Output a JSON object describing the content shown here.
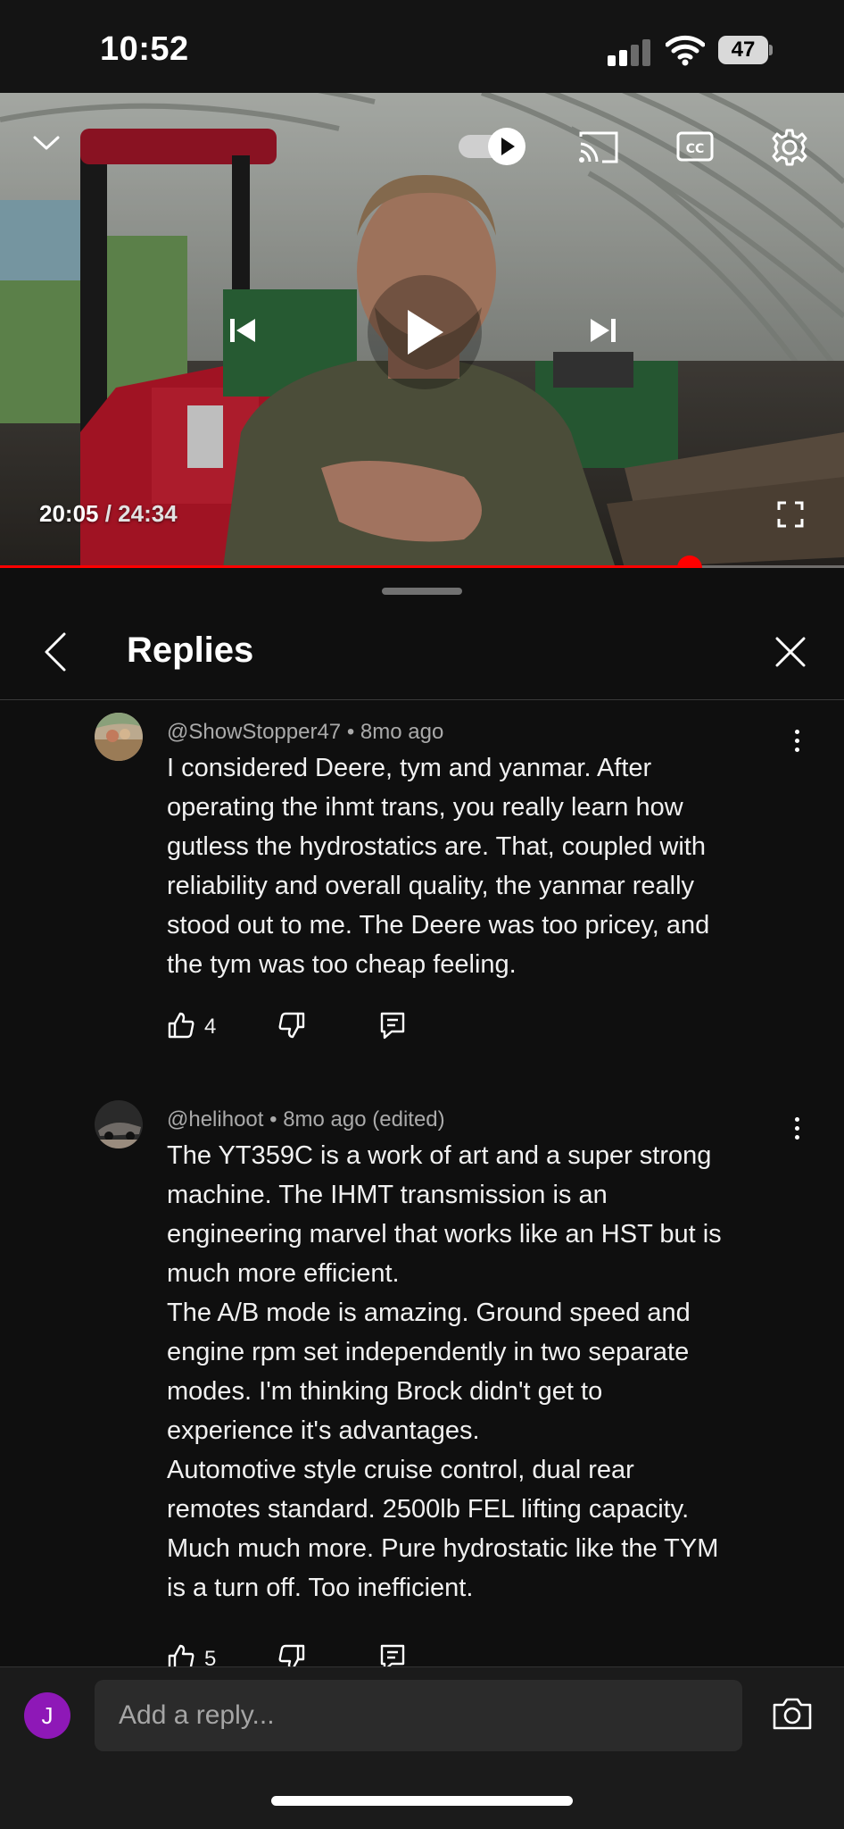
{
  "status_bar": {
    "time": "10:52",
    "battery_level": "47"
  },
  "player": {
    "current_time": "20:05",
    "separator": " / ",
    "duration": "24:34",
    "progress_fraction": 0.817,
    "autoplay_on": true,
    "progress_color": "#ff0000",
    "icons": [
      "collapse-chevron-icon",
      "autoplay-toggle-icon",
      "cast-icon",
      "captions-icon",
      "settings-gear-icon",
      "previous-icon",
      "play-icon",
      "next-icon",
      "fullscreen-icon"
    ]
  },
  "panel": {
    "title": "Replies"
  },
  "comments": [
    {
      "author": "@ShowStopper47",
      "time": "8mo ago",
      "edited": "",
      "lines": [
        "I considered Deere, tym and yanmar. After",
        "operating the ihmt trans, you really learn how",
        "gutless the hydrostatics are.  That, coupled with",
        "reliability and overall quality, the yanmar really",
        "stood out to me. The Deere was too pricey, and",
        "the tym was too cheap feeling."
      ],
      "likes": "4"
    },
    {
      "author": "@helihoot",
      "time": "8mo ago",
      "edited": "(edited)",
      "lines": [
        "The YT359C is a work of art and a super strong",
        "machine. The IHMT transmission is an",
        "engineering marvel that works like an HST but is",
        "much more efficient.",
        "The A/B mode is amazing. Ground speed and",
        "engine rpm set independently in two separate",
        "modes. I'm thinking Brock didn't get to",
        "experience it's advantages.",
        "Automotive style cruise control, dual rear",
        "remotes standard. 2500lb FEL lifting capacity.",
        "Much much more. Pure hydrostatic like the TYM",
        "is a turn off. Too inefficient."
      ],
      "likes": "5"
    }
  ],
  "reply_bar": {
    "user_initial": "J",
    "placeholder": "Add a reply...",
    "avatar_color": "#8e18b7"
  }
}
